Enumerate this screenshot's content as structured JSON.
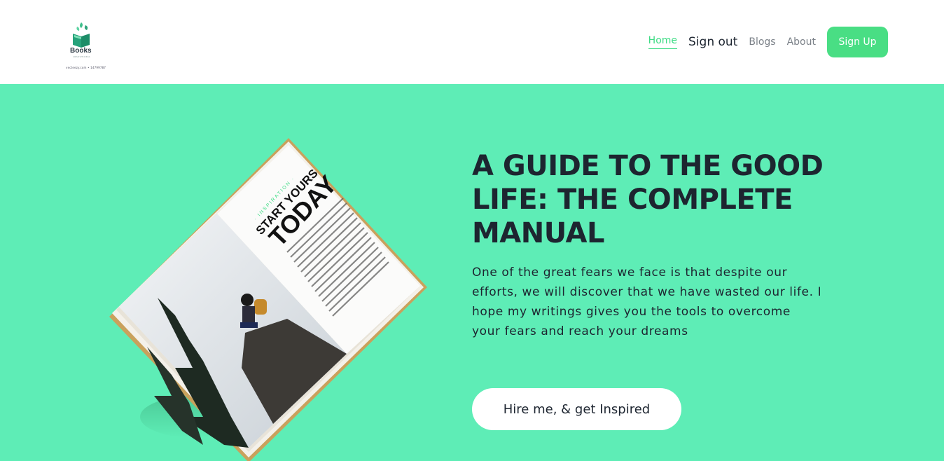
{
  "header": {
    "logo_text": "Books",
    "logo_tagline": "CREATIVE IDEAS",
    "logo_small": "vecteezy.com • 14799787",
    "nav": {
      "home": "Home",
      "sign_out": "Sign out",
      "blogs": "Blogs",
      "about": "About",
      "sign_up": "Sign Up"
    }
  },
  "hero": {
    "title": "A GUIDE TO THE GOOD LIFE: THE COMPLETE MANUAL",
    "description": "One of the great fears we face is that despite our efforts, we will discover that we have wasted our life. I hope my writings gives you the tools to overcome your fears and reach your dreams",
    "cta": "Hire me, & get Inspired",
    "book": {
      "kicker": "· INSPIRATION ·",
      "headline_small": "START YOURS",
      "headline_big": "TODAY"
    }
  },
  "colors": {
    "accent": "#3ddc84",
    "hero_bg": "#5eedb6",
    "text_dark": "#1d2530",
    "signup_bg": "#49de84"
  }
}
